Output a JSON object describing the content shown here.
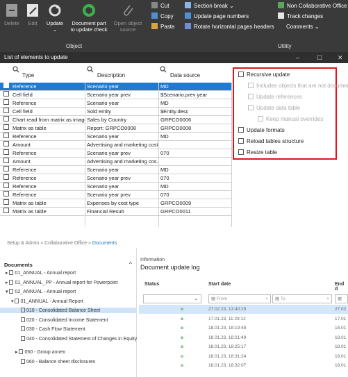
{
  "ribbon": {
    "delete": "Delete",
    "edit": "Edit",
    "update": "Update",
    "update_sub": "⌄",
    "doc_part": "Document part",
    "doc_part_sub": "to update check",
    "open_source": "Open object",
    "open_source_sub": "source",
    "group_object": "Object",
    "cut": "Cut",
    "copy": "Copy",
    "paste": "Paste",
    "section_break": "Section break ⌄",
    "update_page_numbers": "Update page numbers",
    "rotate_headers": "Rotate horizontal pages headers",
    "non_collab": "Non Collaborative Office",
    "track_changes": "Track changes",
    "comments": "Comments ⌄",
    "group_utility": "Utility"
  },
  "window": {
    "title": "List of elements to update",
    "min": "–",
    "max": "☐",
    "close": "✕"
  },
  "table": {
    "col_type": "Type",
    "col_desc": "Description",
    "col_source": "Data source",
    "rows": [
      {
        "type": "Reference",
        "desc": "Scenario year",
        "source": "MD"
      },
      {
        "type": "Cell field",
        "desc": "Scenario year prev",
        "source": "$Scenario.prev year"
      },
      {
        "type": "Reference",
        "desc": "Scenario year",
        "source": "MD"
      },
      {
        "type": "Cell field",
        "desc": "Sold entity",
        "source": "$Entity.desc"
      },
      {
        "type": "Chart read from matrix as image",
        "desc": "Sales by Country",
        "source": "GRPCO0006"
      },
      {
        "type": "Matrix as table",
        "desc": "Report: GRPCO0008",
        "source": "GRPCO0008"
      },
      {
        "type": "Reference",
        "desc": "Scenario year",
        "source": "MD"
      },
      {
        "type": "Amount",
        "desc": "Advertising and marketing costs",
        "source": ""
      },
      {
        "type": "Reference",
        "desc": "Scenario year prev",
        "source": "070"
      },
      {
        "type": "Amount",
        "desc": "Advertising and marketing cos...",
        "source": ""
      },
      {
        "type": "Reference",
        "desc": "Scenario year",
        "source": "MD"
      },
      {
        "type": "Reference",
        "desc": "Scenario year prev",
        "source": "070"
      },
      {
        "type": "Reference",
        "desc": "Scenario year",
        "source": "MD"
      },
      {
        "type": "Reference",
        "desc": "Scenario year prev",
        "source": "070"
      },
      {
        "type": "Matrix as table",
        "desc": "Expenses by cost type",
        "source": "GRPCO0009"
      },
      {
        "type": "Matrix as table",
        "desc": "Financial Result",
        "source": "GRPCO0011"
      }
    ]
  },
  "options": {
    "recursive": "Recursive update",
    "includes": "Includes objects that are not document p",
    "update_refs": "Update references",
    "update_table": "Update data table",
    "keep_manual": "Keep manual overrides",
    "update_formats": "Update formats",
    "reload_tables": "Reload tables structure",
    "resize_table": "Resize table"
  },
  "breadcrumb": {
    "a": "Setup & Admin",
    "sep": "»",
    "b": "Collaborative Office",
    "c": "Documents"
  },
  "docs": {
    "title": "Documents",
    "items": [
      "01_ANNUAL - Annual report",
      "01_ANNUAL_PP - Annual report for Powerpoint",
      "02_ANNUAL - Annual report",
      "01_ANNUAL - Annual Report",
      "010 - Consolidated Balance Sheet",
      "020 - Consolidated Income Statement",
      "030 - Cash Flow Statement",
      "040 - Consolidated Statement of Changes in Equity",
      "050 - Group annex",
      "060 - Balance sheet disclosures"
    ]
  },
  "info": {
    "label": "Information",
    "title": "Document update log",
    "col_status": "Status",
    "col_start": "Start date",
    "col_end": "End d",
    "from_ph": "From",
    "to_ph": "To",
    "status_icon": "o",
    "rows": [
      {
        "start": "27.02.23, 13:40:29",
        "end": "27.02"
      },
      {
        "start": "17.01.23, 11:29:12",
        "end": "17.01"
      },
      {
        "start": "18.01.23, 18:19:48",
        "end": "18.01"
      },
      {
        "start": "18.01.23, 18:21:49",
        "end": "18.01"
      },
      {
        "start": "18.01.23, 18:25:17",
        "end": "18.01"
      },
      {
        "start": "18.01.23, 18:31:24",
        "end": "18.01"
      },
      {
        "start": "18.01.23, 18:32:07",
        "end": "18.01"
      }
    ]
  }
}
